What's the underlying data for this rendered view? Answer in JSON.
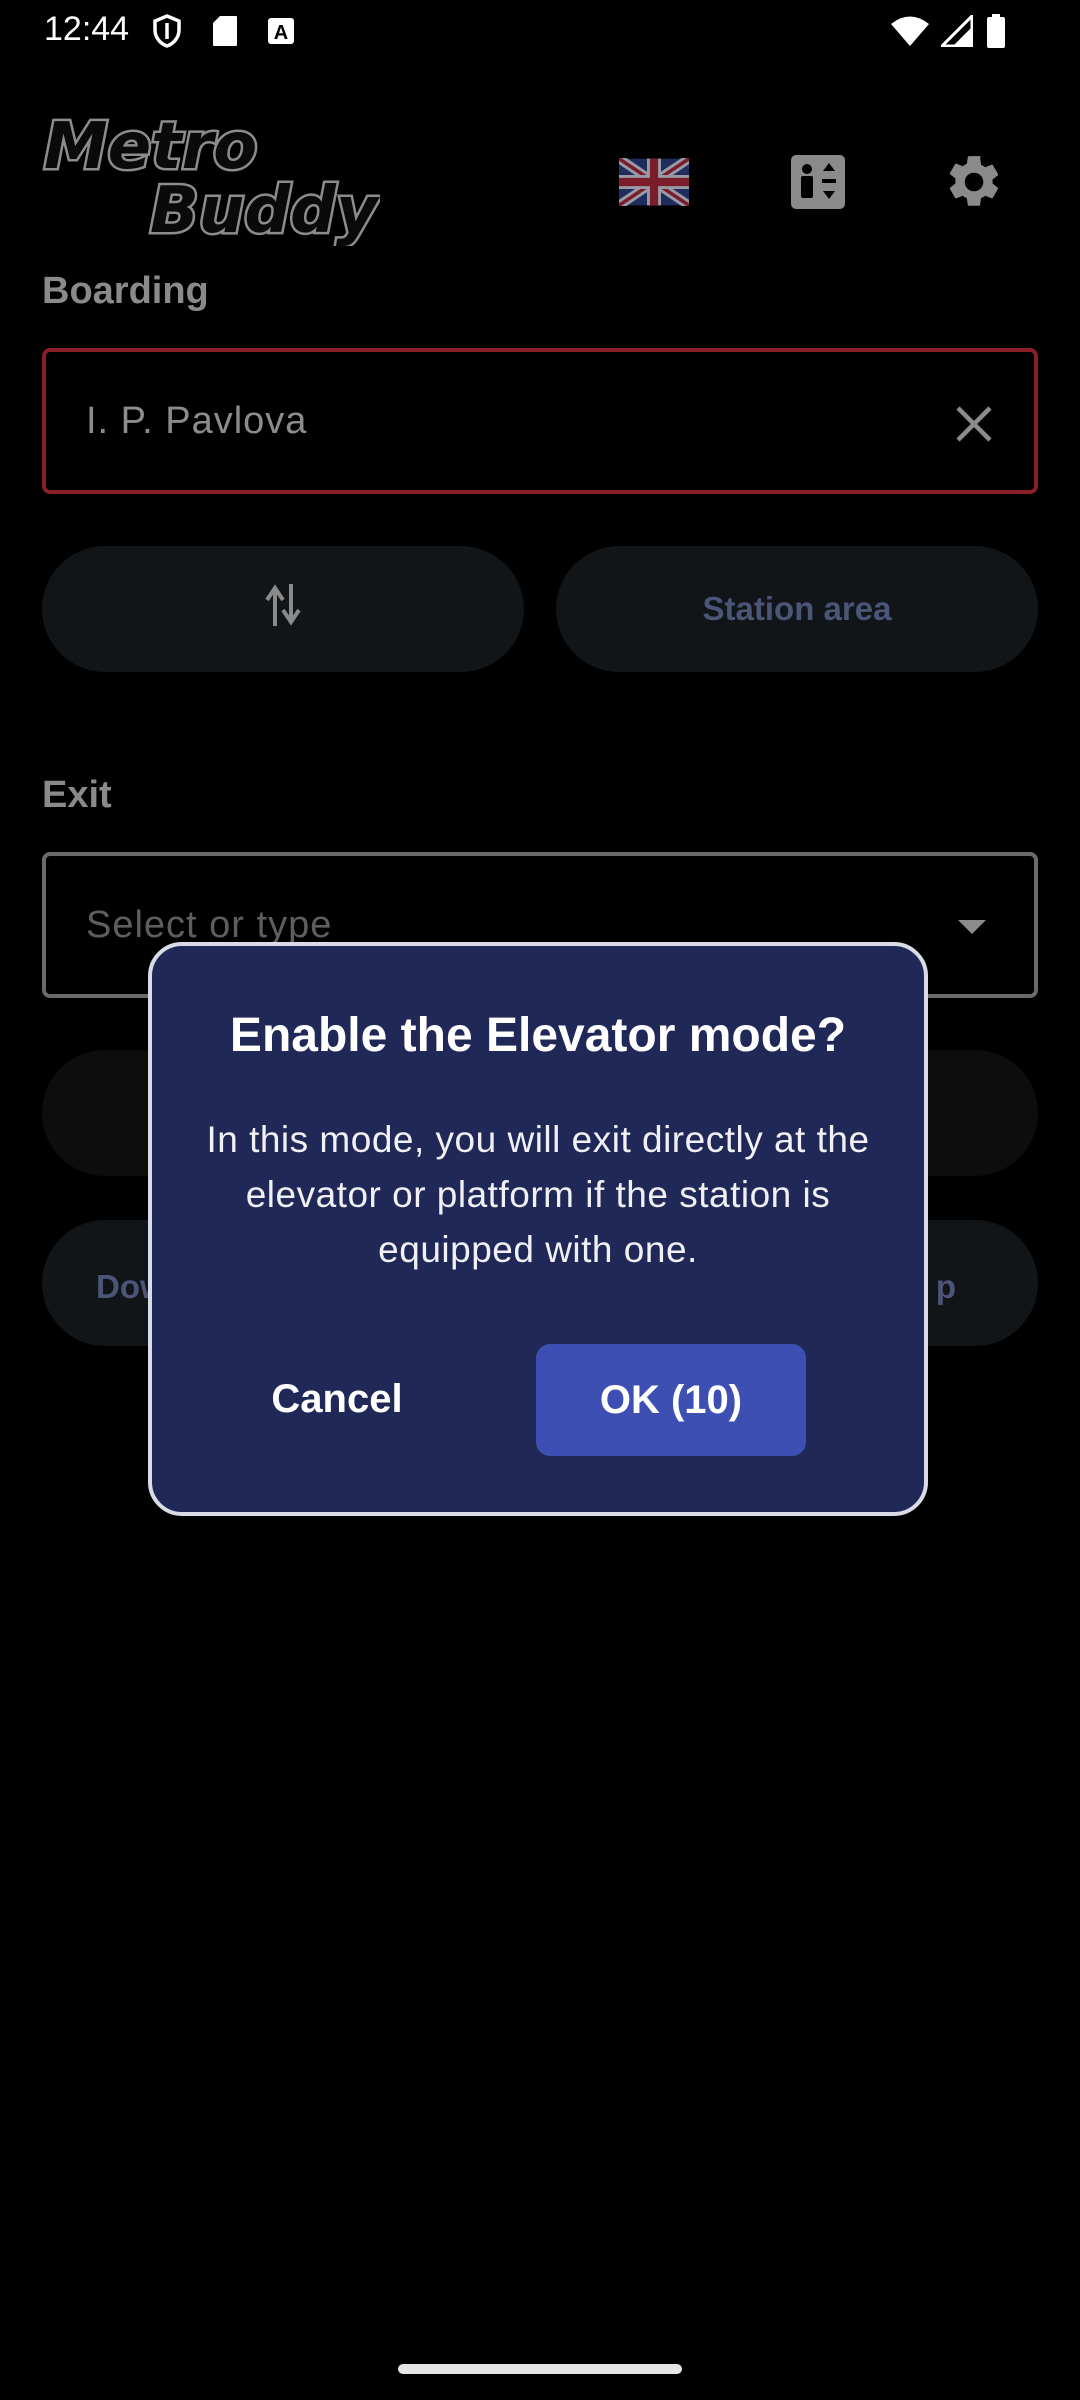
{
  "status_bar": {
    "time": "12:44",
    "icons_left": [
      "shield-icon",
      "sd-card-icon",
      "font-a-icon"
    ],
    "icons_right": [
      "wifi-icon",
      "signal-icon",
      "battery-icon"
    ]
  },
  "header": {
    "logo_text": "MetroBuddy",
    "language_flag": "uk-flag-icon",
    "elevator_icon": "elevator-icon",
    "settings_icon": "gear-icon"
  },
  "boarding": {
    "label": "Boarding",
    "value": "I. P. Pavlova",
    "clear_icon": "close-icon"
  },
  "actions": {
    "swap_icon": "swap-vertical-icon",
    "station_area_label": "Station area"
  },
  "exit": {
    "label": "Exit",
    "placeholder": "Select or type",
    "dropdown_icon": "caret-down-icon"
  },
  "partial_buttons": {
    "left_fragment": "Dow",
    "right_fragment": "p"
  },
  "dialog": {
    "title": "Enable the Elevator mode?",
    "body": "In this mode, you will exit directly at the elevator or platform if the station is equipped with one.",
    "cancel_label": "Cancel",
    "ok_label": "OK (10)"
  },
  "colors": {
    "dialog_bg": "#1f2857",
    "ok_button": "#3e4fb4",
    "error_border": "#8a1f28",
    "pill_bg": "#121518"
  }
}
